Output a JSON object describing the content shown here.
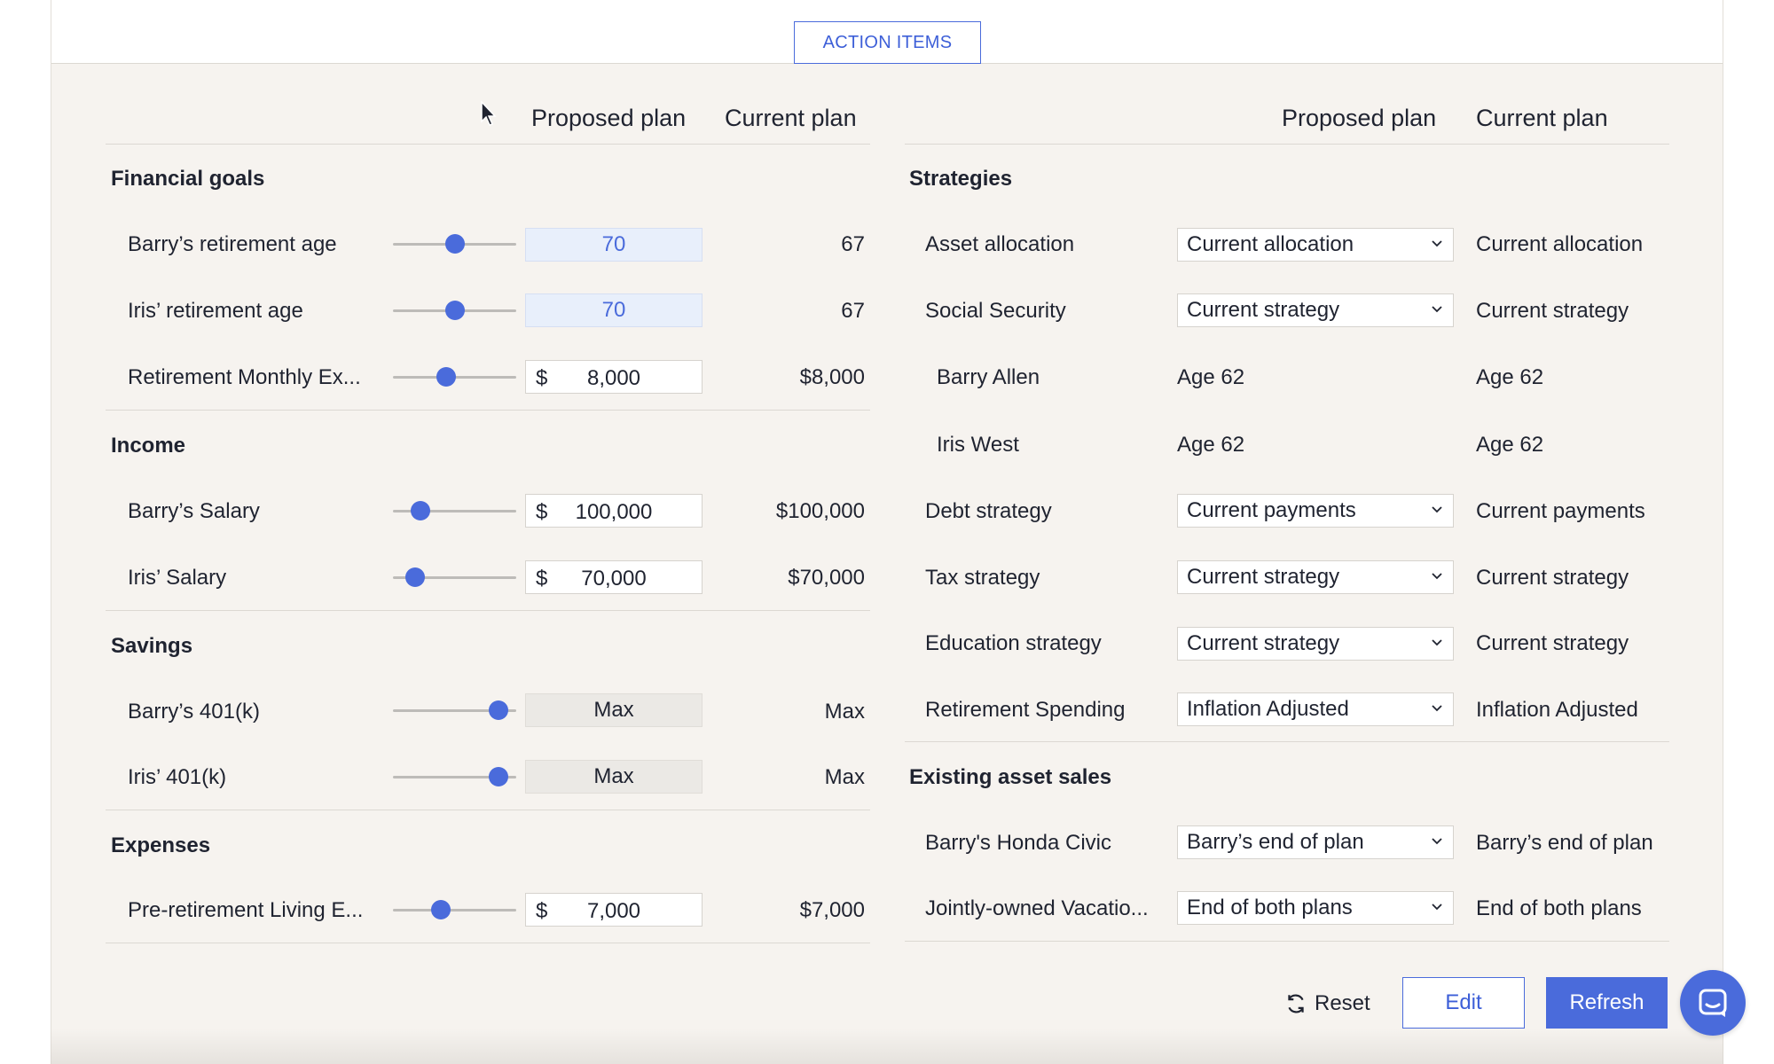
{
  "top": {
    "action_items_label": "ACTION ITEMS"
  },
  "left_panel": {
    "col_proposed": "Proposed plan",
    "col_current": "Current plan",
    "sections": {
      "financial_goals": "Financial goals",
      "income": "Income",
      "savings": "Savings",
      "expenses": "Expenses"
    },
    "rows": {
      "barry_retirement": {
        "label": "Barry’s retirement age",
        "proposed": "70",
        "current": "67",
        "slider": 0.5
      },
      "iris_retirement": {
        "label": "Iris’ retirement age",
        "proposed": "70",
        "current": "67",
        "slider": 0.5
      },
      "monthly_expenses": {
        "label": "Retirement Monthly Ex...",
        "currency": "$",
        "proposed": "8,000",
        "current": "$8,000",
        "slider": 0.42
      },
      "barry_salary": {
        "label": "Barry’s Salary",
        "currency": "$",
        "proposed": "100,000",
        "current": "$100,000",
        "slider": 0.17
      },
      "iris_salary": {
        "label": "Iris’ Salary",
        "currency": "$",
        "proposed": "70,000",
        "current": "$70,000",
        "slider": 0.12
      },
      "barry_401k": {
        "label": "Barry’s 401(k)",
        "proposed": "Max",
        "current": "Max",
        "slider": 0.92
      },
      "iris_401k": {
        "label": "Iris’ 401(k)",
        "proposed": "Max",
        "current": "Max",
        "slider": 0.92
      },
      "living_expenses": {
        "label": "Pre-retirement Living E...",
        "currency": "$",
        "proposed": "7,000",
        "current": "$7,000",
        "slider": 0.37
      }
    }
  },
  "right_panel": {
    "col_proposed": "Proposed plan",
    "col_current": "Current plan",
    "sections": {
      "strategies": "Strategies",
      "asset_sales": "Existing asset sales"
    },
    "rows": {
      "asset_allocation": {
        "label": "Asset allocation",
        "proposed": "Current allocation",
        "current": "Current allocation"
      },
      "social_security": {
        "label": "Social Security",
        "proposed": "Current strategy",
        "current": "Current strategy"
      },
      "barry_allen": {
        "label": "Barry Allen",
        "proposed": "Age 62",
        "current": "Age 62"
      },
      "iris_west": {
        "label": "Iris West",
        "proposed": "Age 62",
        "current": "Age 62"
      },
      "debt_strategy": {
        "label": "Debt strategy",
        "proposed": "Current payments",
        "current": "Current payments"
      },
      "tax_strategy": {
        "label": "Tax strategy",
        "proposed": "Current strategy",
        "current": "Current strategy"
      },
      "education_strategy": {
        "label": "Education strategy",
        "proposed": "Current strategy",
        "current": "Current strategy"
      },
      "retirement_spending": {
        "label": "Retirement Spending",
        "proposed": "Inflation Adjusted",
        "current": "Inflation Adjusted"
      },
      "honda_civic": {
        "label": "Barry's Honda Civic",
        "proposed": "Barry’s end of plan",
        "current": "Barry’s end of plan"
      },
      "vacation_home": {
        "label": "Jointly-owned Vacatio...",
        "proposed": "End of both plans",
        "current": "End of both plans"
      }
    }
  },
  "footer": {
    "reset_label": "Reset",
    "edit_label": "Edit",
    "refresh_label": "Refresh"
  },
  "colors": {
    "accent": "#4a6bdb",
    "background": "#f6f3ef"
  },
  "icons": {
    "reset": "refresh-icon",
    "chevron": "chevron-down-icon",
    "chat": "chat-icon",
    "cursor": "mouse-cursor-icon"
  }
}
